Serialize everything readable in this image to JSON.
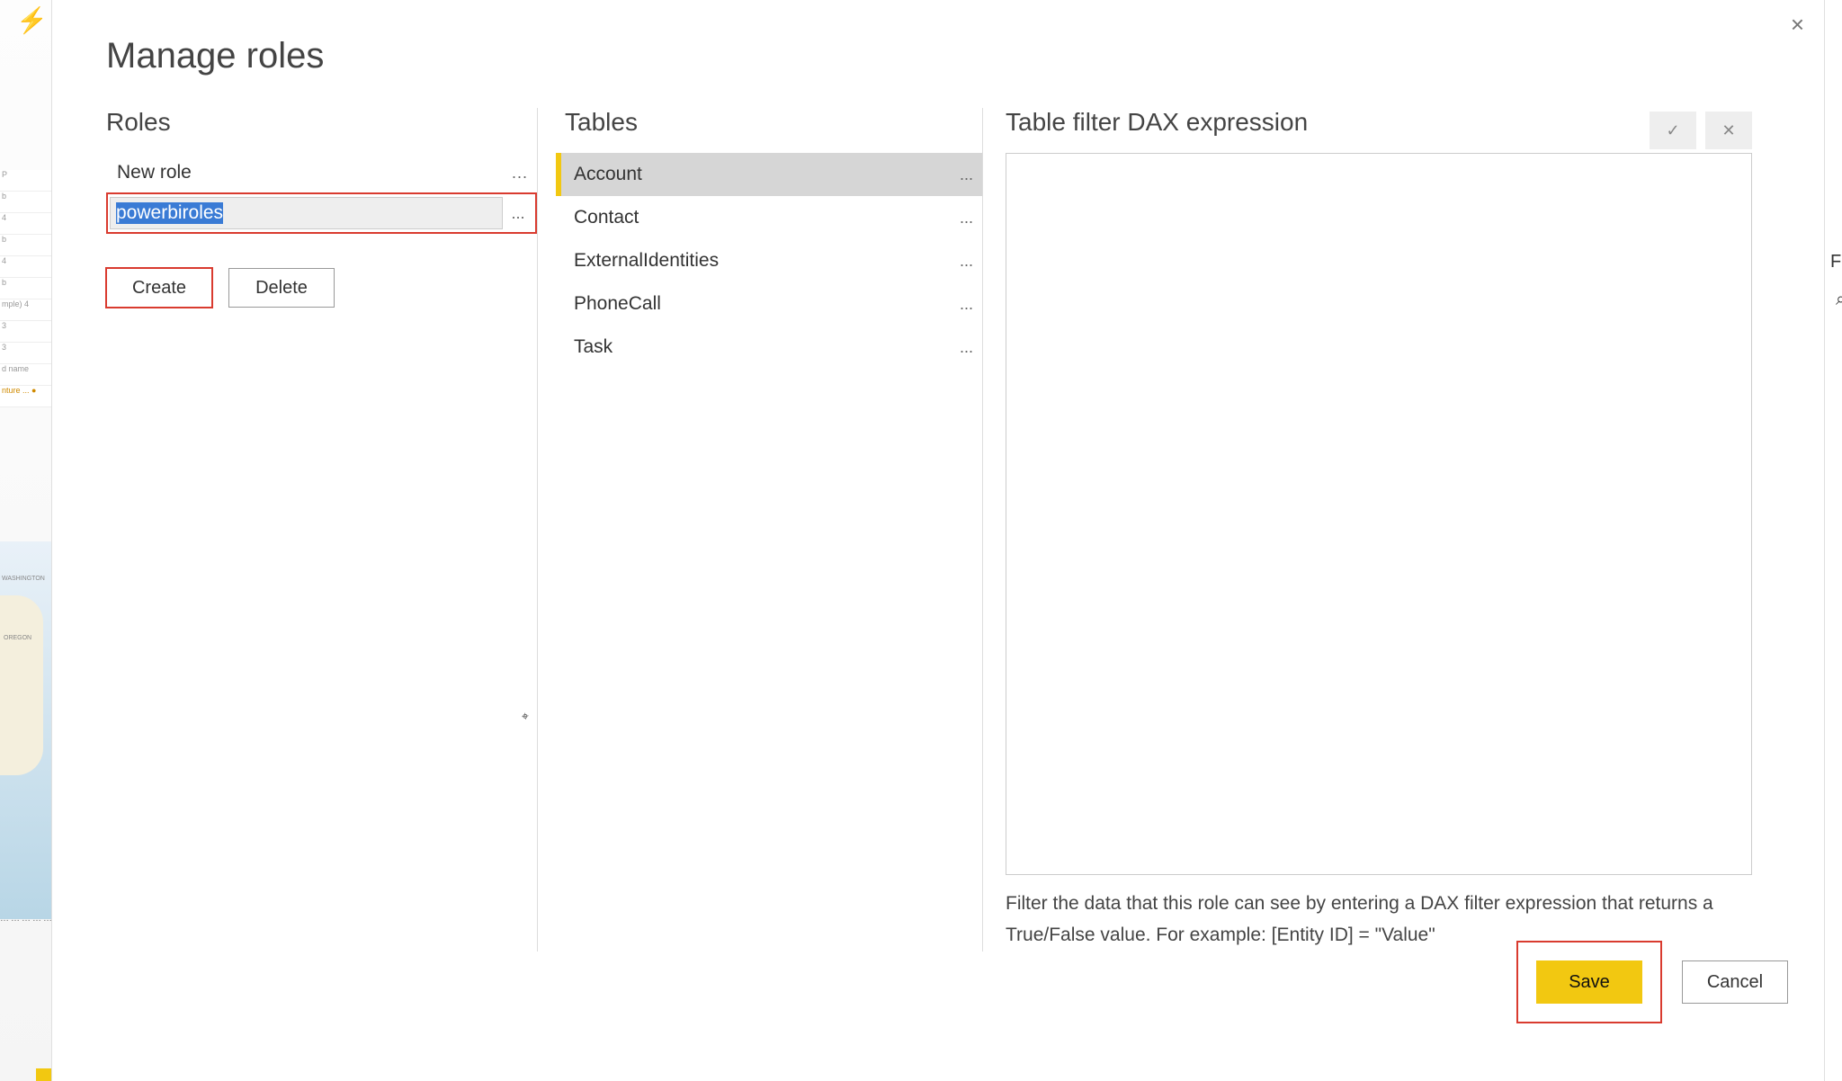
{
  "dialog": {
    "title": "Manage roles",
    "close_icon": "×"
  },
  "roles": {
    "header": "Roles",
    "items": [
      {
        "label": "New role"
      },
      {
        "label": "powerbiroles"
      }
    ],
    "editing_value": "powerbiroles",
    "ellipsis": "...",
    "create_label": "Create",
    "delete_label": "Delete"
  },
  "tables": {
    "header": "Tables",
    "items": [
      {
        "label": "Account",
        "selected": true
      },
      {
        "label": "Contact",
        "selected": false
      },
      {
        "label": "ExternalIdentities",
        "selected": false
      },
      {
        "label": "PhoneCall",
        "selected": false
      },
      {
        "label": "Task",
        "selected": false
      }
    ],
    "ellipsis": "..."
  },
  "dax": {
    "header": "Table filter DAX expression",
    "accept_icon": "✓",
    "reject_icon": "✕",
    "textarea_value": "",
    "help_text": "Filter the data that this role can see by entering a DAX filter expression that returns a True/False value. For example: [Entity ID] = \"Value\""
  },
  "footer": {
    "save_label": "Save",
    "cancel_label": "Cancel"
  },
  "bg": {
    "bolt": "⚡",
    "washington": "WASHINGTON",
    "oregon": "OREGON",
    "plus": "+"
  }
}
